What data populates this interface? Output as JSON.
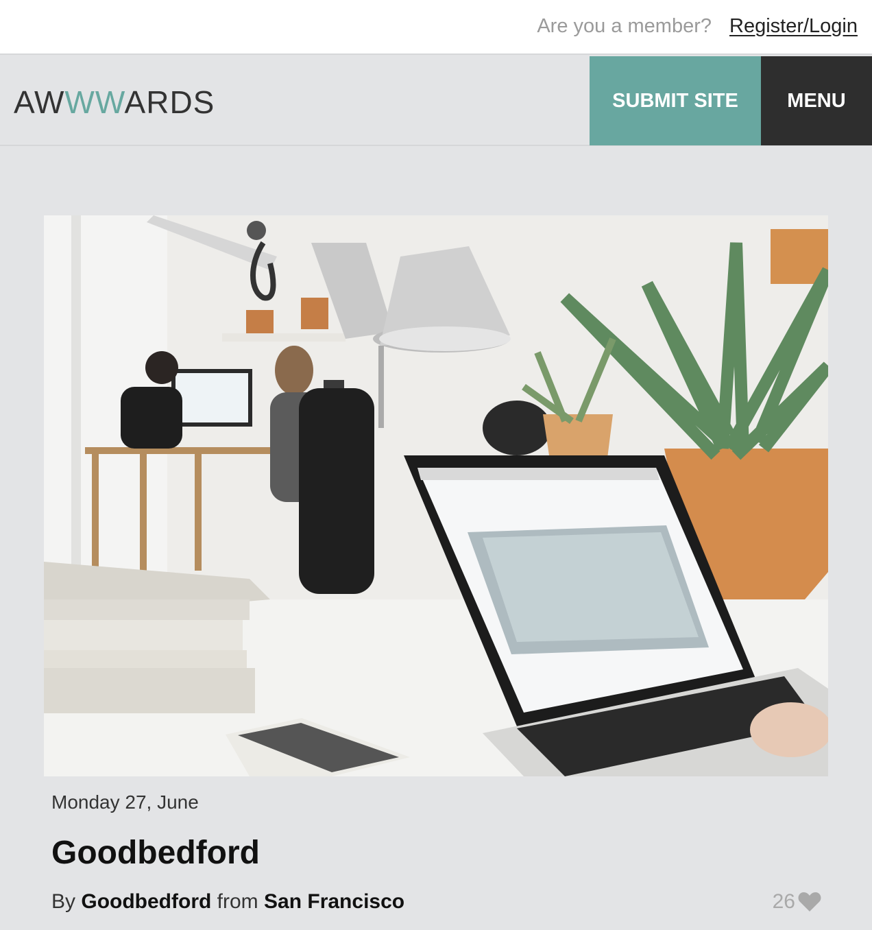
{
  "topbar": {
    "member_prompt": "Are you a member?",
    "login_link": "Register/Login"
  },
  "header": {
    "logo": {
      "part1": "AW",
      "part2": "WW",
      "part3": "ARDS"
    },
    "submit_button": "SUBMIT SITE",
    "menu_button": "MENU"
  },
  "article": {
    "date": "Monday 27, June",
    "title": "Goodbedford",
    "by_label": "By",
    "author": "Goodbedford",
    "from_label": "from",
    "location": "San Francisco",
    "likes": "26",
    "like_icon": "heart-icon"
  },
  "colors": {
    "accent": "#68a7a0",
    "dark": "#2e2e2e",
    "background": "#e3e4e6"
  }
}
